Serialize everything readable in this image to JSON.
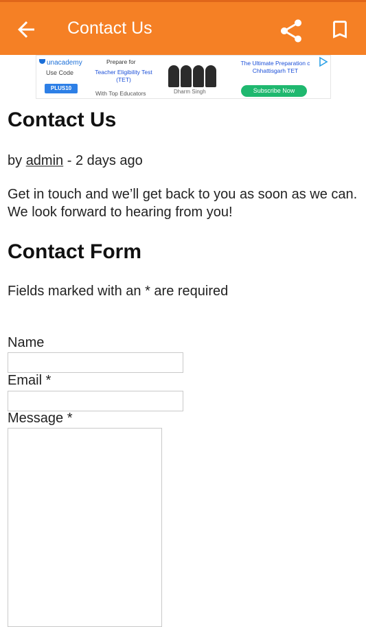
{
  "appbar": {
    "title": "Contact Us",
    "back_icon": "arrow-left-icon",
    "share_icon": "share-icon",
    "bookmark_icon": "bookmark-icon",
    "color": "#f58025"
  },
  "ad": {
    "brand": "unacademy",
    "use_code_label": "Use Code",
    "code": "PLUS10",
    "prepare_for": "Prepare for",
    "exam": "Teacher Eligibility Test (TET)",
    "educators": "With Top Educators",
    "educator_name": "Dharm Singh",
    "headline": "The Ultimate Preparation c Chhattisgarh TET",
    "cta": "Subscribe Now"
  },
  "article": {
    "title": "Contact Us",
    "by_prefix": "by",
    "author": "admin",
    "time": "- 2 days ago",
    "intro": "Get in touch and we’ll get back to you as soon as we can. We look forward to hearing from you!"
  },
  "form": {
    "title": "Contact Form",
    "required_note": "Fields marked with an * are required",
    "name_label": "Name",
    "name_value": "",
    "email_label": "Email *",
    "email_value": "",
    "message_label": "Message *",
    "message_value": ""
  }
}
